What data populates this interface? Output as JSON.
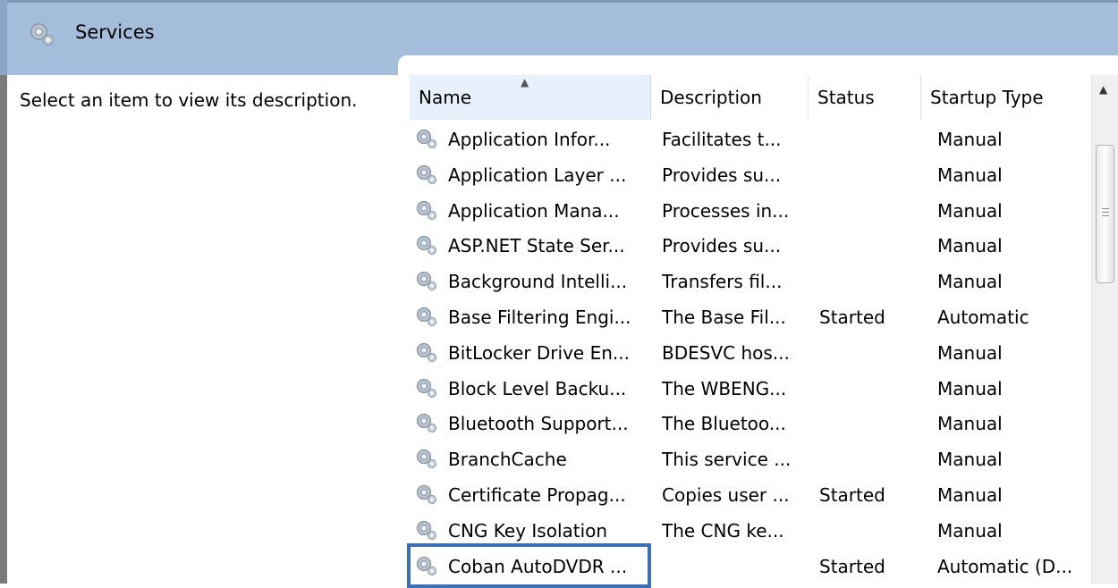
{
  "window": {
    "title": "Services",
    "title_icon": "services-gear-icon"
  },
  "description_pane": {
    "text": "Select an item to view its description."
  },
  "columns": {
    "name": "Name",
    "description": "Description",
    "status": "Status",
    "startup_type": "Startup Type",
    "sorted_by": "Name",
    "sort_direction": "ascending"
  },
  "services": [
    {
      "name": "Application Infor...",
      "description": "Facilitates t...",
      "status": "",
      "startup_type": "Manual"
    },
    {
      "name": "Application Layer ...",
      "description": "Provides su...",
      "status": "",
      "startup_type": "Manual"
    },
    {
      "name": "Application Mana...",
      "description": "Processes in...",
      "status": "",
      "startup_type": "Manual"
    },
    {
      "name": "ASP.NET State Ser...",
      "description": "Provides su...",
      "status": "",
      "startup_type": "Manual"
    },
    {
      "name": "Background Intelli...",
      "description": "Transfers fil...",
      "status": "",
      "startup_type": "Manual"
    },
    {
      "name": "Base Filtering Engi...",
      "description": "The Base Fil...",
      "status": "Started",
      "startup_type": "Automatic"
    },
    {
      "name": "BitLocker Drive En...",
      "description": "BDESVC hos...",
      "status": "",
      "startup_type": "Manual"
    },
    {
      "name": "Block Level Backu...",
      "description": "The WBENG...",
      "status": "",
      "startup_type": "Manual"
    },
    {
      "name": "Bluetooth Support...",
      "description": "The Bluetoo...",
      "status": "",
      "startup_type": "Manual"
    },
    {
      "name": "BranchCache",
      "description": "This service ...",
      "status": "",
      "startup_type": "Manual"
    },
    {
      "name": "Certificate Propag...",
      "description": "Copies user ...",
      "status": "Started",
      "startup_type": "Manual"
    },
    {
      "name": "CNG Key Isolation",
      "description": "The CNG ke...",
      "status": "",
      "startup_type": "Manual"
    },
    {
      "name": "Coban AutoDVDR ...",
      "description": "",
      "status": "Started",
      "startup_type": "Automatic (D..."
    }
  ],
  "highlighted_service": "Coban AutoDVDR ...",
  "colors": {
    "header_bg": "#a3bddb",
    "highlight_border": "#3b6fb6"
  }
}
